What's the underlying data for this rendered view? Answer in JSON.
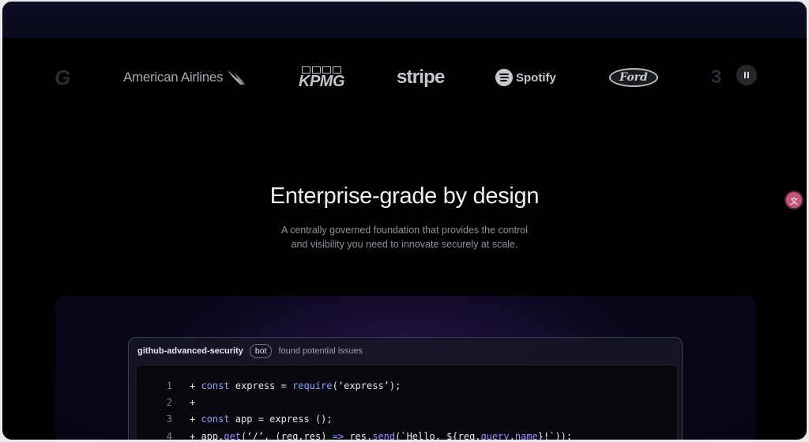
{
  "logos": {
    "american_airlines": "American Airlines",
    "kpmg": "KPMG",
    "stripe": "stripe",
    "spotify": "Spotify",
    "ford": "Ford"
  },
  "hero": {
    "title": "Enterprise-grade by design",
    "subtitle": "A centrally governed foundation that provides the control and visibility you need to innovate securely at scale."
  },
  "card": {
    "user": "github-advanced-security",
    "badge": "bot",
    "message": "found potential issues"
  },
  "code_lines": [
    {
      "num": "1",
      "plus": "+ ",
      "segments": [
        "const",
        " express = ",
        "require",
        "(‘express’);"
      ]
    },
    {
      "num": "2",
      "plus": "+",
      "segments": []
    },
    {
      "num": "3",
      "plus": "+ ",
      "segments": [
        "const",
        " app = express ();"
      ]
    },
    {
      "num": "4",
      "plus": "+ ",
      "segments": [
        "app.",
        "get",
        "(‘/’, (req,res) ",
        "=>",
        " res.",
        "send",
        "(`Hello, ${req.",
        "query",
        ".",
        "name",
        "}!`));"
      ]
    }
  ],
  "colors": {
    "keyword": "#8aa7ff",
    "function": "#9b8cff",
    "accent_glow": "#3a2278"
  }
}
